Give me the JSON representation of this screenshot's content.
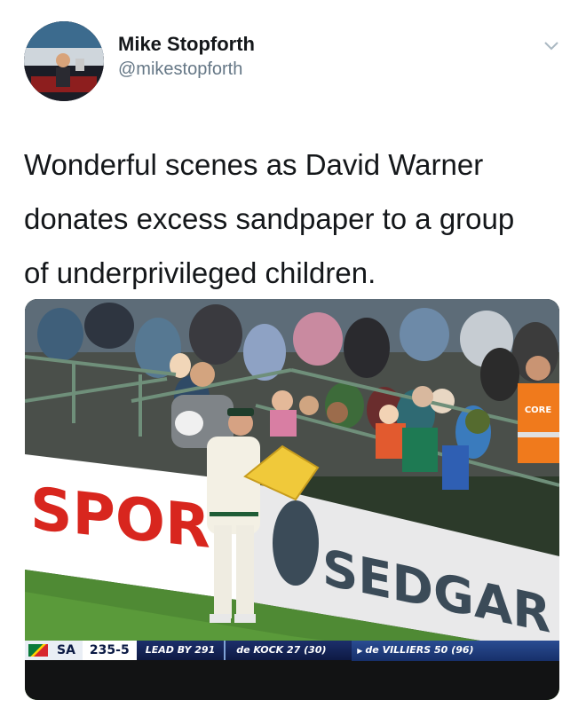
{
  "tweet": {
    "display_name": "Mike Stopforth",
    "handle": "@mikestopforth",
    "text_lines": [
      "Wonderful scenes as David Warner",
      "donates excess sandpaper to a group",
      "of underprivileged children."
    ],
    "menu_icon": "chevron-down-icon"
  },
  "media": {
    "billboard_left": "SPOR",
    "billboard_right": "SEDGAR",
    "bib_text": "CORE",
    "scorebar": {
      "team": "SA",
      "score": "235-5",
      "lead": "LEAD BY 291",
      "batter1": "de KOCK 27 (30)",
      "batter2": "de VILLIERS 50 (96)"
    }
  },
  "colors": {
    "handle_gray": "#657786",
    "board_red": "#d8261e",
    "sandpaper_yellow": "#f0c93a",
    "score_navy": "#14275e"
  }
}
